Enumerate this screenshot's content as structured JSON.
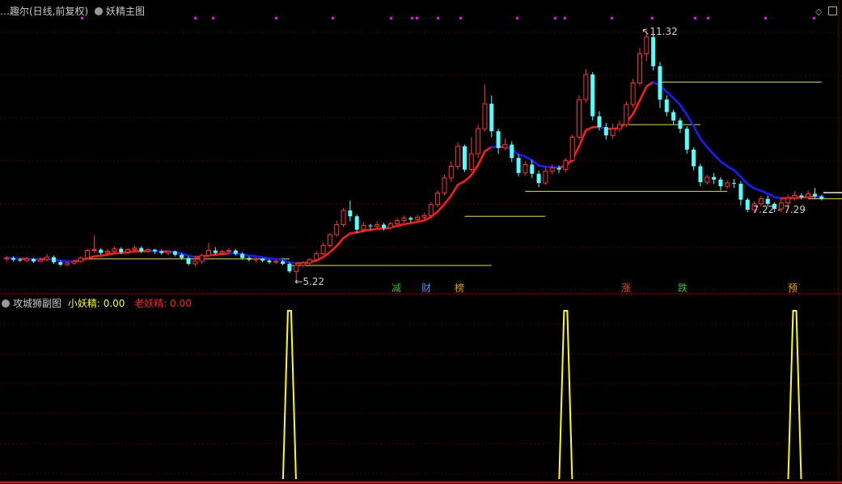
{
  "main_panel": {
    "stock_name": "…趣尔(日线,前复权)",
    "indicator_name": "妖精主图",
    "high_label": "11.32",
    "low_label": "5.22",
    "range_label": "7.22 - 7.29",
    "signals": [
      {
        "text": "减",
        "color": "#2dbf2d"
      },
      {
        "text": "财",
        "color": "#4a8cff"
      },
      {
        "text": "榜",
        "color": "#e8a000"
      },
      {
        "text": "涨",
        "color": "#ff3c3c"
      },
      {
        "text": "跌",
        "color": "#2dbf2d"
      },
      {
        "text": "预",
        "color": "#e8a000"
      }
    ],
    "colors": {
      "up": "#ff3232",
      "down": "#54ffff",
      "ma_up": "#ff1a1a",
      "ma_down": "#1a1aff",
      "support": "#e6e600",
      "grid": "#550000"
    }
  },
  "sub_panel": {
    "title": "攻城狮副图",
    "series": [
      {
        "name": "小妖精",
        "value": "0.00",
        "color": "#ffff00"
      },
      {
        "name": "老妖精",
        "value": "0.00",
        "color": "#ff2020"
      }
    ]
  },
  "chart_data": {
    "type": "candlestick",
    "grid": true,
    "candles": [
      [
        5.78,
        5.8,
        5.85,
        5.72
      ],
      [
        5.8,
        5.76,
        5.84,
        5.72
      ],
      [
        5.76,
        5.74,
        5.8,
        5.7
      ],
      [
        5.74,
        5.78,
        5.82,
        5.7
      ],
      [
        5.78,
        5.72,
        5.8,
        5.68
      ],
      [
        5.72,
        5.76,
        5.82,
        5.7
      ],
      [
        5.76,
        5.82,
        5.9,
        5.72
      ],
      [
        5.82,
        5.7,
        5.86,
        5.66
      ],
      [
        5.7,
        5.64,
        5.74,
        5.6
      ],
      [
        5.64,
        5.68,
        5.72,
        5.6
      ],
      [
        5.68,
        5.72,
        5.76,
        5.64
      ],
      [
        5.72,
        5.8,
        5.84,
        5.68
      ],
      [
        5.8,
        5.98,
        6.02,
        5.78
      ],
      [
        5.98,
        6.0,
        6.34,
        5.92
      ],
      [
        6.0,
        5.92,
        6.04,
        5.88
      ],
      [
        5.92,
        5.96,
        6.02,
        5.88
      ],
      [
        5.96,
        6.02,
        6.08,
        5.92
      ],
      [
        6.02,
        5.94,
        6.06,
        5.9
      ],
      [
        5.94,
        6.0,
        6.04,
        5.9
      ],
      [
        6.0,
        6.04,
        6.1,
        5.96
      ],
      [
        6.04,
        5.96,
        6.08,
        5.92
      ],
      [
        5.96,
        6.0,
        6.04,
        5.92
      ],
      [
        6.0,
        5.96,
        6.02,
        5.9
      ],
      [
        5.96,
        5.92,
        6.0,
        5.88
      ],
      [
        5.92,
        5.96,
        5.98,
        5.86
      ],
      [
        5.96,
        5.88,
        5.98,
        5.84
      ],
      [
        5.88,
        5.8,
        5.92,
        5.76
      ],
      [
        5.8,
        5.66,
        5.84,
        5.62
      ],
      [
        5.66,
        5.72,
        5.78,
        5.6
      ],
      [
        5.72,
        5.86,
        5.9,
        5.66
      ],
      [
        5.86,
        5.98,
        6.16,
        5.82
      ],
      [
        5.98,
        5.92,
        6.06,
        5.88
      ],
      [
        5.92,
        5.96,
        6.0,
        5.88
      ],
      [
        5.96,
        5.98,
        6.04,
        5.9
      ],
      [
        5.98,
        5.9,
        6.02,
        5.86
      ],
      [
        5.9,
        5.8,
        5.94,
        5.76
      ],
      [
        5.8,
        5.76,
        5.84,
        5.72
      ],
      [
        5.76,
        5.78,
        5.82,
        5.7
      ],
      [
        5.78,
        5.74,
        5.8,
        5.7
      ],
      [
        5.74,
        5.7,
        5.78,
        5.66
      ],
      [
        5.7,
        5.72,
        5.76,
        5.66
      ],
      [
        5.72,
        5.66,
        5.76,
        5.62
      ],
      [
        5.66,
        5.48,
        5.7,
        5.44
      ],
      [
        5.48,
        5.62,
        5.66,
        5.22
      ],
      [
        5.62,
        5.68,
        5.72,
        5.58
      ],
      [
        5.68,
        5.76,
        5.8,
        5.64
      ],
      [
        5.76,
        5.9,
        5.96,
        5.72
      ],
      [
        5.9,
        6.1,
        6.16,
        5.86
      ],
      [
        6.1,
        6.36,
        6.4,
        6.04
      ],
      [
        6.36,
        6.6,
        6.7,
        6.3
      ],
      [
        6.6,
        6.94,
        7.0,
        6.54
      ],
      [
        6.94,
        6.8,
        7.18,
        6.68
      ],
      [
        6.8,
        6.48,
        6.84,
        6.4
      ],
      [
        6.48,
        6.58,
        6.66,
        6.42
      ],
      [
        6.58,
        6.56,
        6.62,
        6.48
      ],
      [
        6.56,
        6.6,
        6.68,
        6.5
      ],
      [
        6.6,
        6.52,
        6.64,
        6.46
      ],
      [
        6.52,
        6.62,
        6.68,
        6.48
      ],
      [
        6.62,
        6.7,
        6.76,
        6.58
      ],
      [
        6.7,
        6.76,
        6.82,
        6.66
      ],
      [
        6.76,
        6.72,
        6.8,
        6.66
      ],
      [
        6.72,
        6.78,
        6.84,
        6.68
      ],
      [
        6.78,
        6.82,
        6.88,
        6.72
      ],
      [
        6.82,
        7.08,
        7.14,
        6.78
      ],
      [
        7.08,
        7.36,
        7.42,
        7.02
      ],
      [
        7.36,
        7.72,
        7.8,
        7.3
      ],
      [
        7.72,
        8.0,
        8.12,
        7.62
      ],
      [
        8.0,
        8.48,
        8.58,
        7.92
      ],
      [
        8.48,
        7.92,
        8.52,
        7.86
      ],
      [
        7.92,
        8.3,
        8.7,
        7.86
      ],
      [
        8.3,
        8.9,
        9.0,
        8.2
      ],
      [
        8.9,
        9.5,
        9.96,
        8.84
      ],
      [
        9.5,
        8.84,
        9.7,
        8.7
      ],
      [
        8.84,
        8.44,
        8.9,
        8.3
      ],
      [
        8.44,
        8.52,
        8.66,
        8.38
      ],
      [
        8.52,
        8.2,
        8.6,
        8.1
      ],
      [
        8.2,
        7.84,
        8.28,
        7.76
      ],
      [
        7.84,
        8.04,
        8.12,
        7.78
      ],
      [
        8.04,
        7.82,
        8.16,
        7.72
      ],
      [
        7.82,
        7.6,
        7.9,
        7.5
      ],
      [
        7.6,
        7.88,
        7.98,
        7.56
      ],
      [
        7.88,
        7.96,
        8.04,
        7.8
      ],
      [
        7.96,
        7.92,
        8.02,
        7.84
      ],
      [
        7.92,
        8.14,
        8.2,
        7.86
      ],
      [
        8.14,
        8.7,
        8.76,
        8.08
      ],
      [
        8.7,
        9.6,
        9.7,
        8.64
      ],
      [
        9.6,
        10.2,
        10.34,
        9.52
      ],
      [
        10.2,
        9.2,
        10.26,
        9.1
      ],
      [
        9.2,
        8.94,
        9.32,
        8.86
      ],
      [
        8.94,
        8.74,
        9.04,
        8.64
      ],
      [
        8.74,
        8.9,
        9.02,
        8.66
      ],
      [
        8.9,
        9.0,
        9.1,
        8.82
      ],
      [
        9.0,
        9.48,
        9.56,
        8.94
      ],
      [
        9.48,
        10.0,
        10.1,
        9.4
      ],
      [
        10.0,
        10.7,
        10.84,
        9.92
      ],
      [
        10.7,
        11.1,
        11.32,
        10.52
      ],
      [
        11.1,
        10.4,
        11.2,
        10.3
      ],
      [
        10.4,
        9.6,
        10.5,
        9.4
      ],
      [
        9.6,
        9.3,
        9.7,
        9.2
      ],
      [
        9.3,
        9.1,
        9.36,
        9.0
      ],
      [
        9.1,
        8.9,
        9.16,
        8.8
      ],
      [
        8.9,
        8.4,
        8.96,
        8.3
      ],
      [
        8.4,
        8.0,
        8.46,
        7.9
      ],
      [
        8.0,
        7.62,
        8.06,
        7.52
      ],
      [
        7.62,
        7.74,
        7.8,
        7.56
      ],
      [
        7.74,
        7.68,
        7.84,
        7.58
      ],
      [
        7.68,
        7.52,
        7.74,
        7.42
      ],
      [
        7.52,
        7.6,
        7.66,
        7.46
      ],
      [
        7.6,
        7.58,
        7.7,
        7.48
      ],
      [
        7.58,
        7.2,
        7.64,
        7.06
      ],
      [
        7.2,
        6.96,
        7.24,
        6.9
      ],
      [
        6.96,
        7.1,
        7.16,
        6.88
      ],
      [
        7.1,
        7.22,
        7.28,
        7.04
      ],
      [
        7.22,
        7.1,
        7.3,
        7.04
      ],
      [
        7.1,
        6.98,
        7.14,
        6.9
      ],
      [
        6.98,
        7.12,
        7.22,
        6.9
      ],
      [
        7.12,
        7.24,
        7.32,
        7.06
      ],
      [
        7.24,
        7.3,
        7.4,
        7.18
      ],
      [
        7.3,
        7.26,
        7.36,
        7.2
      ],
      [
        7.26,
        7.34,
        7.42,
        7.22
      ],
      [
        7.34,
        7.28,
        7.48,
        7.22
      ],
      [
        7.28,
        7.22,
        7.32,
        7.18
      ]
    ],
    "support_lines": [
      {
        "from": 12,
        "to": 42,
        "price": 5.78
      },
      {
        "from": 42,
        "to": 72,
        "price": 5.62
      },
      {
        "from": 68,
        "to": 80,
        "price": 6.8
      },
      {
        "from": 77,
        "to": 107,
        "price": 7.4
      },
      {
        "from": 91,
        "to": 103,
        "price": 9.0
      },
      {
        "from": 97,
        "to": 121,
        "price": 10.02
      },
      {
        "from": 119,
        "to": 136,
        "price": 7.22
      }
    ],
    "oscillator_spikes": [
      {
        "index": 42,
        "value": 1.0
      },
      {
        "index": 83,
        "value": 1.0
      },
      {
        "index": 117,
        "value": 1.0
      }
    ]
  }
}
